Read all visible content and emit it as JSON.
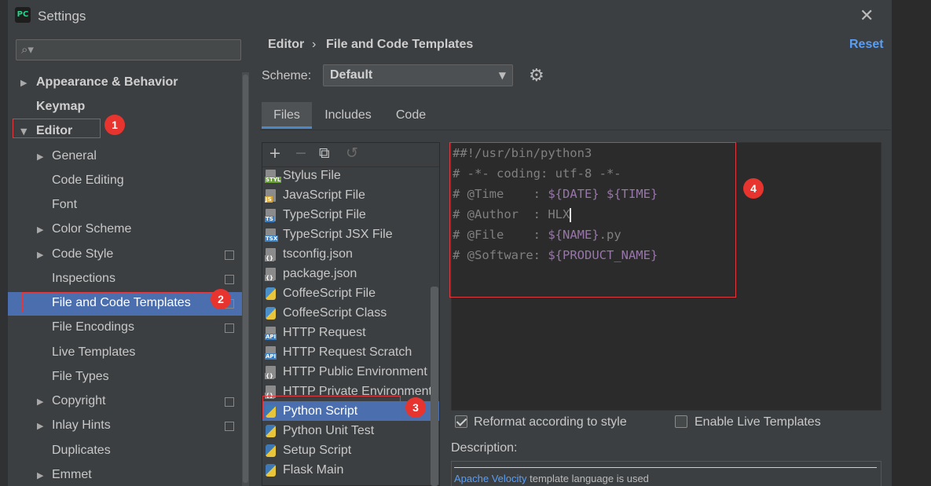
{
  "window": {
    "title": "Settings",
    "app_icon_text": "PC",
    "close_glyph": "✕"
  },
  "search": {
    "icon": "search-icon",
    "glyph": "⌕▾",
    "placeholder": ""
  },
  "sidebar": {
    "items": [
      {
        "label": "Appearance & Behavior",
        "expandable": true,
        "bold": true
      },
      {
        "label": "Keymap",
        "bold": true
      },
      {
        "label": "Editor",
        "expanded": true,
        "bold": true
      },
      {
        "label": "General",
        "expandable": true
      },
      {
        "label": "Code Editing"
      },
      {
        "label": "Font"
      },
      {
        "label": "Color Scheme",
        "expandable": true
      },
      {
        "label": "Code Style",
        "expandable": true,
        "project_icon": true
      },
      {
        "label": "Inspections",
        "project_icon": true
      },
      {
        "label": "File and Code Templates",
        "selected": true,
        "project_icon": true
      },
      {
        "label": "File Encodings",
        "project_icon": true
      },
      {
        "label": "Live Templates"
      },
      {
        "label": "File Types"
      },
      {
        "label": "Copyright",
        "expandable": true,
        "project_icon": true
      },
      {
        "label": "Inlay Hints",
        "expandable": true,
        "project_icon": true
      },
      {
        "label": "Duplicates"
      },
      {
        "label": "Emmet",
        "expandable": true
      }
    ]
  },
  "annotations": [
    "1",
    "2",
    "3",
    "4"
  ],
  "breadcrumb": {
    "part1": "Editor",
    "sep": "›",
    "part2": "File and Code Templates"
  },
  "reset_label": "Reset",
  "scheme": {
    "label": "Scheme:",
    "value": "Default",
    "dropdown_glyph": "▼",
    "gear_glyph": "⚙"
  },
  "tabs": [
    {
      "label": "Files",
      "active": true
    },
    {
      "label": "Includes"
    },
    {
      "label": "Code"
    }
  ],
  "toolbar": {
    "add": "+",
    "remove": "−",
    "copy": "⧉",
    "reset": "↺"
  },
  "templates": [
    {
      "label": "Stylus File",
      "tag": "STYL",
      "color": "#6a9e3a"
    },
    {
      "label": "JavaScript File",
      "tag": "JS",
      "color": "#d6a63a"
    },
    {
      "label": "TypeScript File",
      "tag": "TS",
      "color": "#3b7fc4"
    },
    {
      "label": "TypeScript JSX File",
      "tag": "TSX",
      "color": "#3b7fc4"
    },
    {
      "label": "tsconfig.json",
      "tag": "{}",
      "color": "#8b8b8b"
    },
    {
      "label": "package.json",
      "tag": "{}",
      "color": "#8b8b8b"
    },
    {
      "label": "CoffeeScript File",
      "tag": "",
      "color": "#4a8fc7"
    },
    {
      "label": "CoffeeScript Class",
      "tag": "",
      "color": "#4a8fc7"
    },
    {
      "label": "HTTP Request",
      "tag": "API",
      "color": "#3b7fc4"
    },
    {
      "label": "HTTP Request Scratch",
      "tag": "API",
      "color": "#3b7fc4"
    },
    {
      "label": "HTTP Public Environment Fi",
      "tag": "{}",
      "color": "#8b8b8b"
    },
    {
      "label": "HTTP Private Environment F",
      "tag": "{}",
      "color": "#8b8b8b"
    },
    {
      "label": "Python Script",
      "tag": "",
      "color": "#3f79b5",
      "selected": true
    },
    {
      "label": "Python Unit Test",
      "tag": "",
      "color": "#3f79b5"
    },
    {
      "label": "Setup Script",
      "tag": "",
      "color": "#3f79b5"
    },
    {
      "label": "Flask Main",
      "tag": "",
      "color": "#3f79b5"
    }
  ],
  "editor": {
    "lines": [
      [
        {
          "t": "##!/usr/bin/python3"
        }
      ],
      [
        {
          "t": "# -*- coding: utf-8 -*-"
        }
      ],
      [
        {
          "t": "# @Time    : "
        },
        {
          "t": "${DATE}",
          "v": true
        },
        {
          "t": " "
        },
        {
          "t": "${TIME}",
          "v": true
        }
      ],
      [
        {
          "t": "# @Author  : HLX"
        },
        {
          "cursor": true
        }
      ],
      [
        {
          "t": "# @File    : "
        },
        {
          "t": "${NAME}",
          "v": true
        },
        {
          "t": ".py"
        }
      ],
      [
        {
          "t": "# @Software: "
        },
        {
          "t": "${PRODUCT_NAME}",
          "v": true
        }
      ]
    ]
  },
  "options": {
    "reformat": {
      "label": "Reformat according to style",
      "checked": true
    },
    "live_templates": {
      "label": "Enable Live Templates",
      "checked": false
    }
  },
  "description": {
    "label": "Description:",
    "link": "Apache Velocity",
    "text": " template language is used"
  }
}
